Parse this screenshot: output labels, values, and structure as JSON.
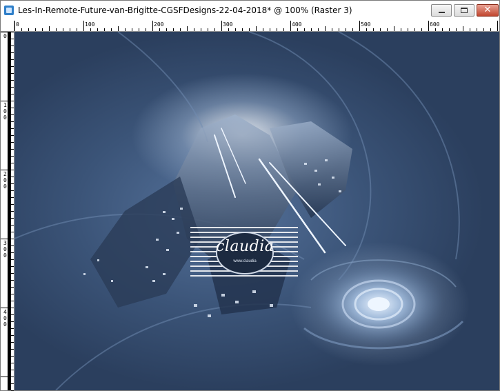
{
  "window": {
    "title": "Les-In-Remote-Future-van-Brigitte-CGSFDesigns-22-04-2018* @ 100% (Raster 3)",
    "minimize_glyph": "",
    "close_glyph": "✕"
  },
  "ruler": {
    "top_labels": [
      "0",
      "100",
      "200",
      "300",
      "400",
      "500",
      "600"
    ],
    "left_labels": [
      "0",
      "100",
      "200",
      "300",
      "400"
    ]
  },
  "watermark": {
    "name": "claudia",
    "tagline": "www.claudia"
  },
  "colors": {
    "close_button": "#c0462f",
    "canvas_dark": "#2b3f5e",
    "canvas_mid": "#3b5478",
    "glow": "#ffffff"
  },
  "icons": [
    "app-icon",
    "minimize-icon",
    "maximize-icon",
    "close-icon"
  ]
}
